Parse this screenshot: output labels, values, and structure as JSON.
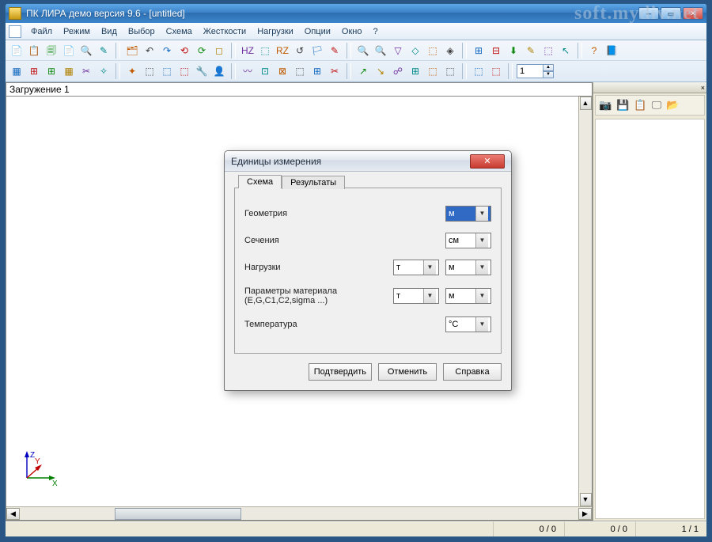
{
  "window": {
    "title": "ПК ЛИРА демо версия 9.6 - [untitled]"
  },
  "watermark": "soft.mydiv.net",
  "menu": {
    "items": [
      "Файл",
      "Режим",
      "Вид",
      "Выбор",
      "Схема",
      "Жесткости",
      "Нагрузки",
      "Опции",
      "Окно",
      "?"
    ]
  },
  "toolbar_spin": "1",
  "canvas": {
    "header": "Загружение  1",
    "axis": {
      "x": "X",
      "y": "Y",
      "z": "Z"
    }
  },
  "status": {
    "left_a": "0 / 0",
    "left_b": "0 / 0",
    "right": "1 / 1"
  },
  "side_panel": {
    "close": "×"
  },
  "dialog": {
    "title": "Единицы измерения",
    "tabs": {
      "active": "Схема",
      "inactive": "Результаты"
    },
    "rows": {
      "geometry": {
        "label": "Геометрия",
        "unit2": "м"
      },
      "section": {
        "label": "Сечения",
        "unit2": "см"
      },
      "loads": {
        "label": "Нагрузки",
        "unit1": "т",
        "unit2": "м"
      },
      "material": {
        "label": "Параметры материала (E,G,C1,C2,sigma ...)",
        "unit1": "т",
        "unit2": "м"
      },
      "temperature": {
        "label": "Температура",
        "unit2": "°C"
      }
    },
    "buttons": {
      "ok": "Подтвердить",
      "cancel": "Отменить",
      "help": "Справка"
    }
  },
  "icons": {
    "row1": [
      "📄",
      "📋",
      "🗐",
      "📄",
      "🔍",
      "✎",
      "🗂",
      "↶",
      "↷",
      "⟲",
      "⟳",
      "◻",
      "HZ",
      "⬚",
      "RZ",
      "↺",
      "🏳",
      "✎",
      "🔍",
      "🔍",
      "▽",
      "◇",
      "⬚",
      "◈",
      "⊞",
      "⊟",
      "⬇",
      "✎",
      "⬚",
      "↖",
      "?",
      "📘"
    ],
    "row2": [
      "▦",
      "⊞",
      "⊞",
      "▦",
      "✂",
      "✧",
      "✦",
      "⬚",
      "⬚",
      "⬚",
      "🔧",
      "👤",
      "〰",
      "⊡",
      "⊠",
      "⬚",
      "⊞",
      "✂",
      "↗",
      "↘",
      "☍",
      "⊞",
      "⬚",
      "⬚",
      "⬚",
      "⬚"
    ],
    "side": [
      "📷",
      "💾",
      "📋",
      "🖵",
      "📂"
    ]
  }
}
